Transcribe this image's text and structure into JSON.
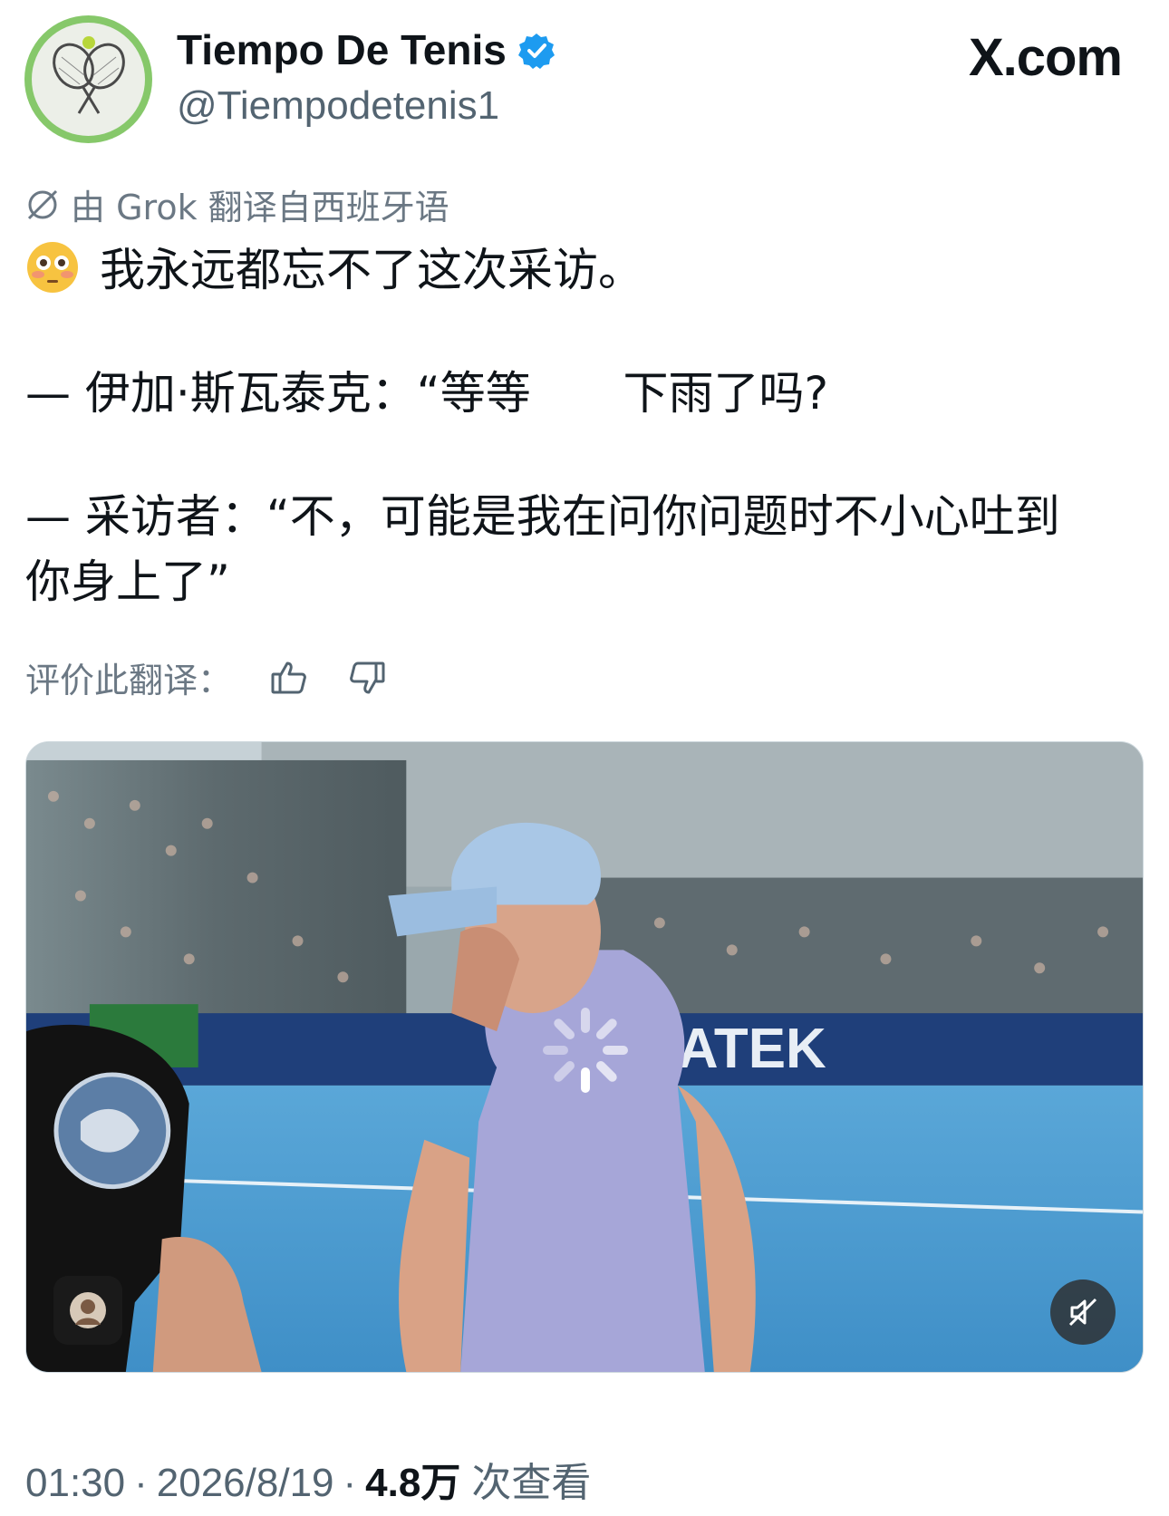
{
  "header": {
    "display_name": "Tiempo De Tenis",
    "handle": "@Tiempodetenis1",
    "brand": "X.com",
    "verified_color": "#1d9bf0"
  },
  "translation_notice": "由 Grok 翻译自西班牙语",
  "tweet": {
    "lines": [
      "我永远都忘不了这次采访。",
      "— 伊加·斯瓦泰克：“等等",
      "下雨了吗?",
      "— 采访者：“不，可能是我在问你问题时不小心吐到",
      "你身上了”"
    ],
    "emoji": "flushed-face-emoji"
  },
  "rate_translation": {
    "label": "评价此翻译：",
    "up_icon": "thumbs-up-icon",
    "down_icon": "thumbs-down-icon"
  },
  "media": {
    "banner_text": "ATEK",
    "banner_text_2": "A",
    "loading": true,
    "muted": true
  },
  "meta": {
    "time": "01:30",
    "date": "2026/8/19",
    "views_count": "4.8万",
    "views_label": "次查看",
    "separator": "·"
  }
}
